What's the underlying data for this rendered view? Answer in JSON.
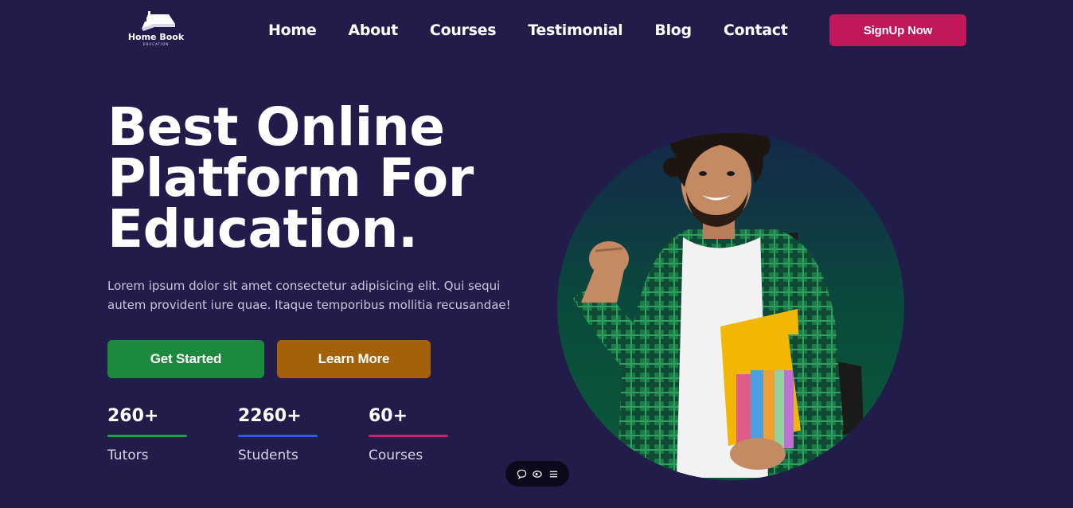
{
  "logo": {
    "name": "Home Book",
    "sub": "EDUCATION"
  },
  "nav": {
    "items": [
      "Home",
      "About",
      "Courses",
      "Testimonial",
      "Blog",
      "Contact"
    ],
    "signup_label": "SignUp Now"
  },
  "hero": {
    "title_lines": [
      "Best Online",
      "Platform For",
      "Education."
    ],
    "description": "Lorem ipsum dolor sit amet consectetur adipisicing elit. Qui sequi autem provident iure quae. Itaque temporibus mollitia recusandae!",
    "primary_button": "Get Started",
    "secondary_button": "Learn More"
  },
  "stats": [
    {
      "value": "260+",
      "label": "Tutors",
      "color": "#1fa04a"
    },
    {
      "value": "2260+",
      "label": "Students",
      "color": "#2f5de0"
    },
    {
      "value": "60+",
      "label": "Courses",
      "color": "#c9256b"
    }
  ],
  "colors": {
    "background": "#221c4b",
    "signup": "#c0185a",
    "get_started": "#1c8a3d",
    "learn_more": "#a5610a",
    "circle": "#0a4a3c"
  },
  "floating_toolbar": {
    "icons": [
      "chat-icon",
      "eye-icon",
      "menu-icon"
    ]
  }
}
